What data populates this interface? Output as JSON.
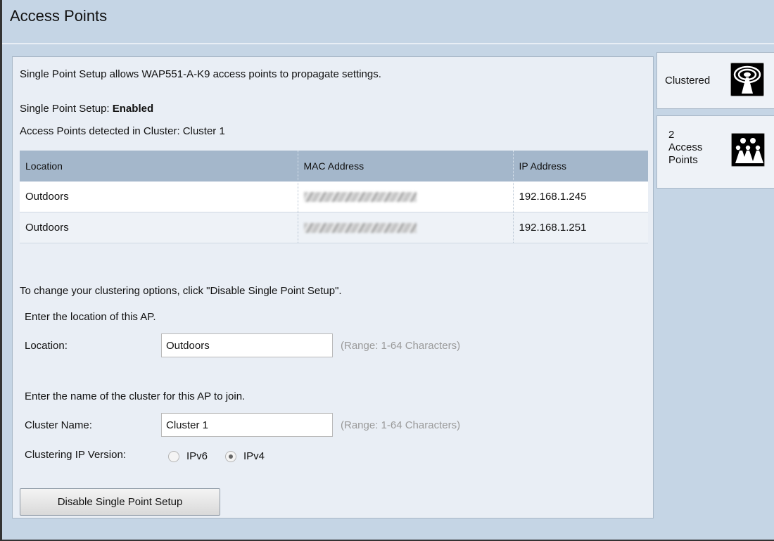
{
  "page": {
    "title": "Access Points"
  },
  "info": {
    "intro": "Single Point Setup allows WAP551-A-K9 access points to propagate settings.",
    "sps_label": "Single Point Setup:",
    "sps_value": "Enabled",
    "detected": "Access Points detected in Cluster: Cluster 1"
  },
  "table": {
    "columns": [
      "Location",
      "MAC Address",
      "IP Address"
    ],
    "rows": [
      {
        "location": "Outdoors",
        "mac": "",
        "ip": "192.168.1.245"
      },
      {
        "location": "Outdoors",
        "mac": "",
        "ip": "192.168.1.251"
      }
    ]
  },
  "form": {
    "change_hint": "To change your clustering options, click \"Disable Single Point Setup\".",
    "location_prompt": "Enter the location of this AP.",
    "location_label": "Location:",
    "location_value": "Outdoors",
    "range_hint": "(Range: 1-64 Characters)",
    "cluster_prompt": "Enter the name of the cluster for this AP to join.",
    "cluster_label": "Cluster Name:",
    "cluster_value": "Cluster 1",
    "ipver_label": "Clustering IP Version:",
    "ipv6_label": "IPv6",
    "ipv4_label": "IPv4",
    "selected_ip_version": "IPv4",
    "disable_button": "Disable Single Point Setup"
  },
  "sidebar": {
    "clustered_label": "Clustered",
    "ap_count": "2",
    "ap_label_line1": "Access",
    "ap_label_line2": "Points",
    "clustered_icon": "wireless-antenna-icon",
    "ap_icon": "access-points-group-icon"
  },
  "colors": {
    "background": "#c5d5e5",
    "panel": "#e9eef5",
    "table_header": "#a4b7cb"
  }
}
